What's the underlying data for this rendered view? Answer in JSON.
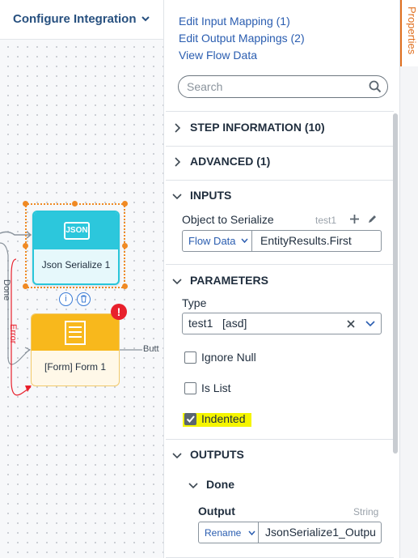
{
  "canvas": {
    "title": "Configure Integration",
    "nodes": {
      "json_serialize": {
        "icon_text": "JSON",
        "label": "Json Serialize 1"
      },
      "form": {
        "label": "[Form] Form 1",
        "error_glyph": "!"
      }
    },
    "edges": {
      "done": "Done",
      "error": "Error",
      "but": "Butt"
    }
  },
  "panel": {
    "links": {
      "edit_input": "Edit Input Mapping (1)",
      "edit_output": "Edit Output Mappings (2)",
      "view_flow": "View Flow Data"
    },
    "search": {
      "placeholder": "Search"
    },
    "sections": {
      "step_info": "STEP INFORMATION (10)",
      "advanced": "ADVANCED (1)",
      "inputs": "INPUTS",
      "parameters": "PARAMETERS",
      "outputs": "OUTPUTS"
    },
    "inputs": {
      "object_label": "Object to Serialize",
      "object_hint": "test1",
      "source": "Flow Data",
      "value": "EntityResults.First"
    },
    "parameters": {
      "type_label": "Type",
      "type_value": "test1   [asd]",
      "checkboxes": [
        {
          "label": "Ignore Null",
          "checked": false
        },
        {
          "label": "Is List",
          "checked": false
        },
        {
          "label": "Indented",
          "checked": true,
          "highlight_color": "#f5f500"
        }
      ]
    },
    "outputs": {
      "done_label": "Done",
      "output_label": "Output",
      "output_type": "String",
      "mode": "Rename",
      "value": "JsonSerialize1_Outpu"
    }
  },
  "properties_tab": {
    "label": "Properties"
  },
  "colors": {
    "accent": "#e07020",
    "link": "#2a5db0",
    "json_node": "#2cc7dc",
    "form_node": "#f8b81c",
    "error": "#e8202c"
  }
}
